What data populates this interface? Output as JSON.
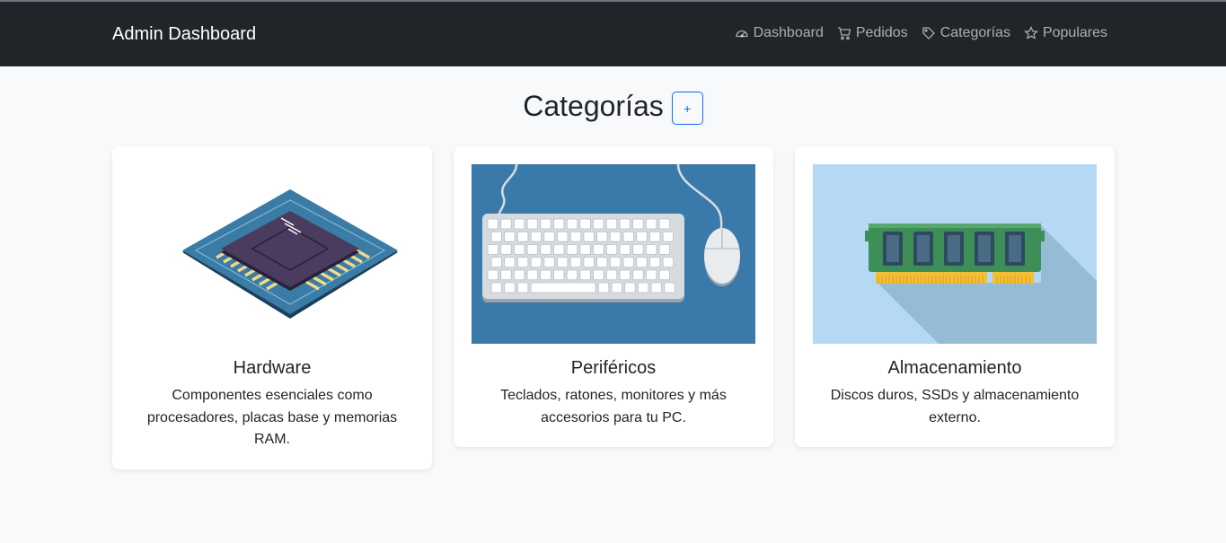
{
  "navbar": {
    "brand": "Admin Dashboard",
    "links": [
      {
        "label": "Dashboard",
        "icon": "speedometer-icon"
      },
      {
        "label": "Pedidos",
        "icon": "cart-icon"
      },
      {
        "label": "Categorías",
        "icon": "tag-icon"
      },
      {
        "label": "Populares",
        "icon": "star-icon"
      }
    ]
  },
  "page": {
    "title": "Categorías",
    "add_label": "+"
  },
  "categories": [
    {
      "title": "Hardware",
      "description": "Componentes esenciales como procesadores, placas base y memorias RAM.",
      "image": "cpu-chip-illustration"
    },
    {
      "title": "Periféricos",
      "description": "Teclados, ratones, monitores y más accesorios para tu PC.",
      "image": "keyboard-mouse-illustration"
    },
    {
      "title": "Almacenamiento",
      "description": "Discos duros, SSDs y almacenamiento externo.",
      "image": "ram-module-illustration"
    }
  ],
  "colors": {
    "navbar_bg": "#212529",
    "page_bg": "#f8f9fa",
    "primary": "#0d6efd"
  }
}
